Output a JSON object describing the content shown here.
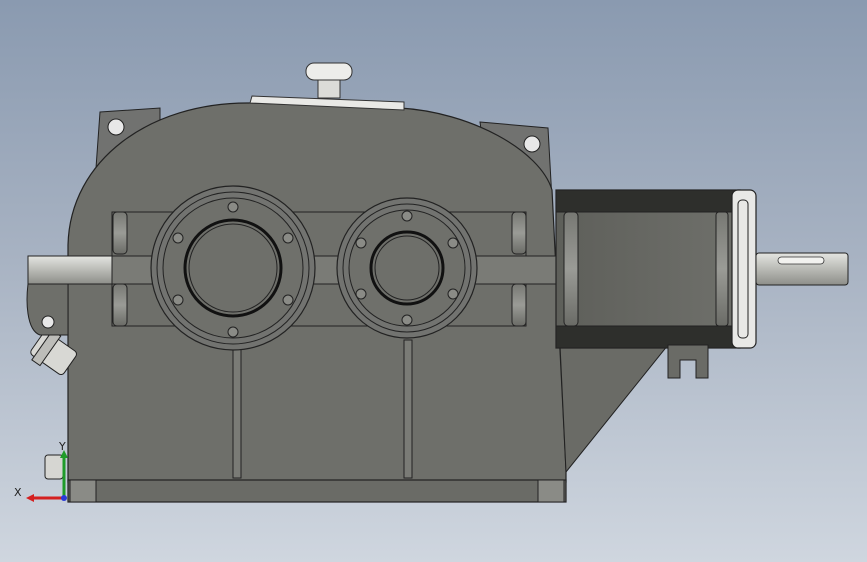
{
  "viewport": {
    "background_top": "#8a9ab0",
    "background_bottom": "#cfd6df",
    "model_color": "#6e6f6a",
    "shaft_color": "#cfd0cc"
  },
  "triad": {
    "x_label": "X",
    "y_label": "Y",
    "x_color": "#d42020",
    "y_color": "#1f9b2a",
    "z_color": "#2a3ad8"
  }
}
